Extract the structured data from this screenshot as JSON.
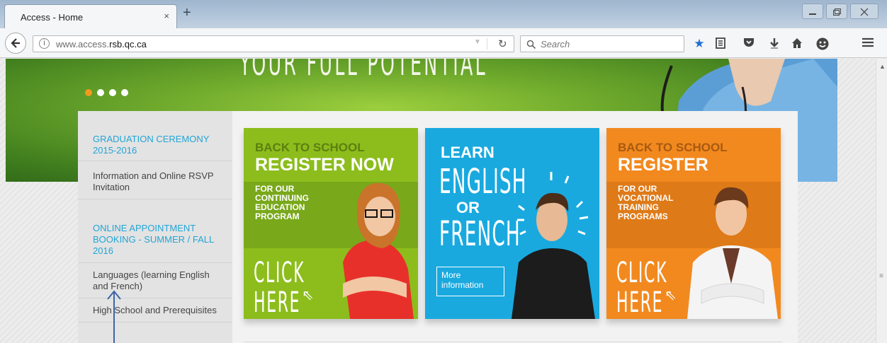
{
  "browser": {
    "tab_title": "Access - Home",
    "tab_close": "×",
    "new_tab": "+",
    "url_prefix": "www.access.",
    "url_domain": "rsb.qc.ca",
    "search_placeholder": "Search",
    "window_buttons": {
      "minimize": "—",
      "restore": "⧉",
      "close": "✕"
    }
  },
  "hero": {
    "headline": "YOUR FULL POTENTIAL",
    "slides_total": 4,
    "active_slide": 1
  },
  "sidebar": {
    "sections": [
      {
        "heading": "GRADUATION CEREMONY 2015-2016",
        "links": [
          "Information and Online RSVP Invitation"
        ]
      },
      {
        "heading": "ONLINE APPOINTMENT BOOKING - SUMMER / FALL 2016",
        "links": [
          "Languages (learning English and French)",
          "High School and Prerequisites"
        ]
      }
    ]
  },
  "banners": {
    "continuing": {
      "kicker": "BACK TO SCHOOL",
      "title": "REGISTER NOW",
      "band_text": "FOR OUR CONTINUING EDUCATION PROGRAM",
      "cta_line1": "CLICK",
      "cta_line2": "HERE"
    },
    "languages": {
      "line1": "LEARN",
      "line2": "ENGLISH",
      "line3": "OR",
      "line4": "FRENCH",
      "button": "More information"
    },
    "vocational": {
      "kicker": "BACK TO SCHOOL",
      "title": "REGISTER",
      "band_text": "FOR OUR VOCATIONAL TRAINING PROGRAMS",
      "cta_line1": "CLICK",
      "cta_line2": "HERE"
    }
  },
  "colors": {
    "accent_blue": "#23a5d5",
    "green_banner": "#8cbd1c",
    "blue_banner": "#19a9df",
    "orange_banner": "#f2891f",
    "active_dot": "#f29a1d"
  }
}
